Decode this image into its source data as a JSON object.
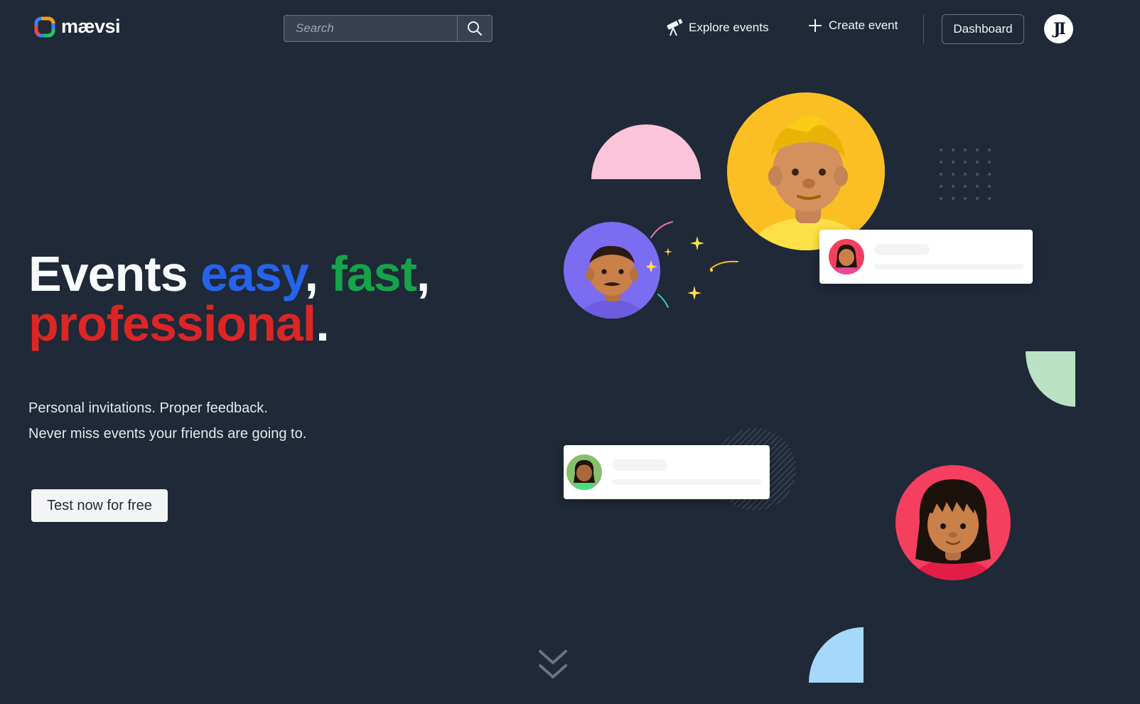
{
  "header": {
    "logo_text": "mævsi",
    "search_placeholder": "Search",
    "nav": {
      "explore_label": "Explore events",
      "create_label": "Create event",
      "dashboard_label": "Dashboard",
      "avatar_initials": "JI"
    }
  },
  "hero": {
    "title_part1": "Events ",
    "title_easy": "easy",
    "title_comma1": ", ",
    "title_fast": "fast",
    "title_comma2": ",",
    "title_professional": "professional",
    "title_period": ".",
    "subtitle_line1": "Personal invitations. Proper feedback.",
    "subtitle_line2": "Never miss events your friends are going to.",
    "cta_label": "Test now for free"
  },
  "colors": {
    "background": "#1f2937",
    "easy": "#2563eb",
    "fast": "#16a34a",
    "professional": "#dc2626",
    "avatar_yellow": "#fbbf24",
    "avatar_purple": "#7c6cf2",
    "avatar_red": "#f43f5e",
    "shape_pink": "#fbc4d8",
    "shape_green": "#bbe3c3",
    "shape_blue": "#a5d8fb"
  },
  "icons": [
    "logo-mark-icon",
    "search-icon",
    "telescope-icon",
    "plus-icon",
    "chevron-double-down-icon"
  ]
}
